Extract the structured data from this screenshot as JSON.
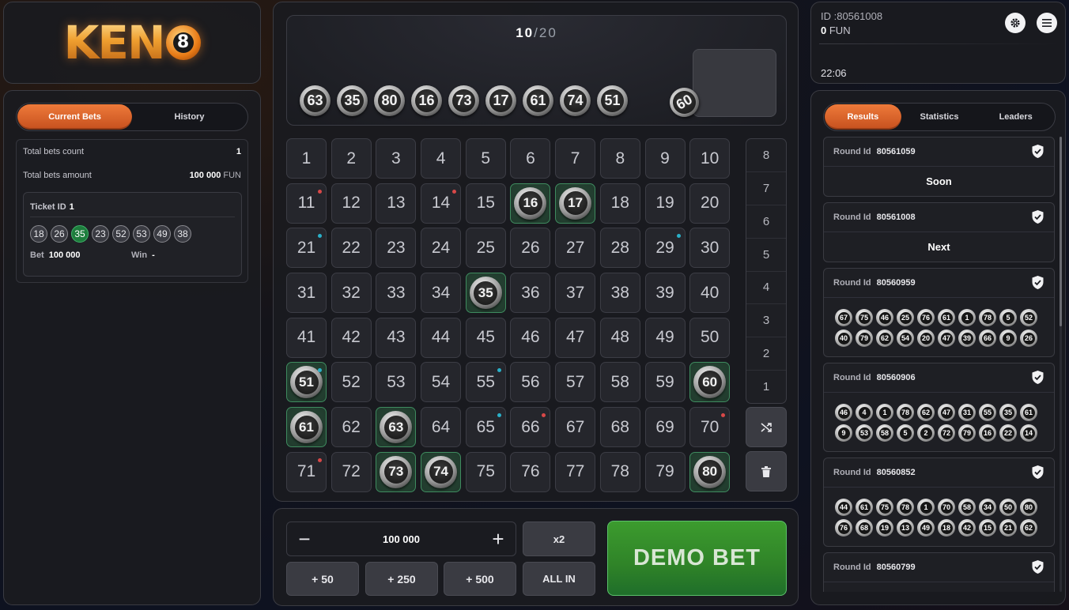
{
  "logo": {
    "text": "KEN",
    "ball": "8"
  },
  "left": {
    "tabs": [
      {
        "label": "Current Bets",
        "active": true
      },
      {
        "label": "History",
        "active": false
      }
    ],
    "total_bets_count_label": "Total bets count",
    "total_bets_count": "1",
    "total_bets_amount_label": "Total bets amount",
    "total_bets_amount": "100 000",
    "currency": "FUN",
    "ticket": {
      "id_label": "Ticket ID",
      "id": "1",
      "numbers": [
        {
          "n": "18",
          "hit": false
        },
        {
          "n": "26",
          "hit": false
        },
        {
          "n": "35",
          "hit": true
        },
        {
          "n": "23",
          "hit": false
        },
        {
          "n": "52",
          "hit": false
        },
        {
          "n": "53",
          "hit": false
        },
        {
          "n": "49",
          "hit": false
        },
        {
          "n": "38",
          "hit": false
        }
      ],
      "bet_label": "Bet",
      "bet": "100 000",
      "win_label": "Win",
      "win": "-"
    }
  },
  "draw": {
    "current": "10",
    "total": "20",
    "balls": [
      "63",
      "35",
      "80",
      "16",
      "73",
      "17",
      "61",
      "74",
      "51"
    ],
    "rolling": "60"
  },
  "board": {
    "selected": [
      16,
      17,
      35,
      51,
      60,
      61,
      63,
      73,
      74,
      80
    ],
    "red_dots": [
      11,
      14,
      66,
      70,
      71
    ],
    "cyan_dots": [
      21,
      29,
      51,
      55,
      65
    ]
  },
  "payouts": [
    "8",
    "7",
    "6",
    "5",
    "4",
    "3",
    "2",
    "1"
  ],
  "bet": {
    "amount": "100 000",
    "minus": "−",
    "plus": "+",
    "quick": [
      "+ 50",
      "+ 250",
      "+ 500"
    ],
    "double_label": "x2",
    "all_in_label": "ALL IN",
    "demo_bet_label": "DEMO BET"
  },
  "user": {
    "id": "ID :80561008",
    "balance": "0",
    "currency": "FUN",
    "clock": "22:06"
  },
  "right": {
    "tabs": [
      {
        "label": "Results",
        "active": true
      },
      {
        "label": "Statistics",
        "active": false
      },
      {
        "label": "Leaders",
        "active": false
      }
    ],
    "round_label": "Round Id",
    "rounds": [
      {
        "id": "80561059",
        "status": "Soon",
        "balls": []
      },
      {
        "id": "80561008",
        "status": "Next",
        "balls": []
      },
      {
        "id": "80560959",
        "status": "",
        "balls": [
          "67",
          "75",
          "46",
          "25",
          "76",
          "61",
          "1",
          "78",
          "5",
          "52",
          "40",
          "79",
          "62",
          "54",
          "20",
          "47",
          "39",
          "66",
          "9",
          "26"
        ]
      },
      {
        "id": "80560906",
        "status": "",
        "balls": [
          "46",
          "4",
          "1",
          "78",
          "62",
          "47",
          "31",
          "55",
          "35",
          "61",
          "9",
          "53",
          "58",
          "5",
          "2",
          "72",
          "79",
          "16",
          "22",
          "14"
        ]
      },
      {
        "id": "80560852",
        "status": "",
        "balls": [
          "44",
          "61",
          "75",
          "78",
          "1",
          "70",
          "58",
          "34",
          "50",
          "80",
          "76",
          "68",
          "19",
          "13",
          "49",
          "18",
          "42",
          "15",
          "21",
          "62"
        ]
      },
      {
        "id": "80560799",
        "status": "",
        "balls": [
          "",
          "",
          "",
          "",
          "",
          "",
          "",
          "",
          "",
          ""
        ]
      }
    ]
  },
  "colors": {
    "accent": "#e8672c",
    "hit": "#1e7d3d",
    "bet_green": "#2f8328",
    "panel": "#1a1b20"
  }
}
